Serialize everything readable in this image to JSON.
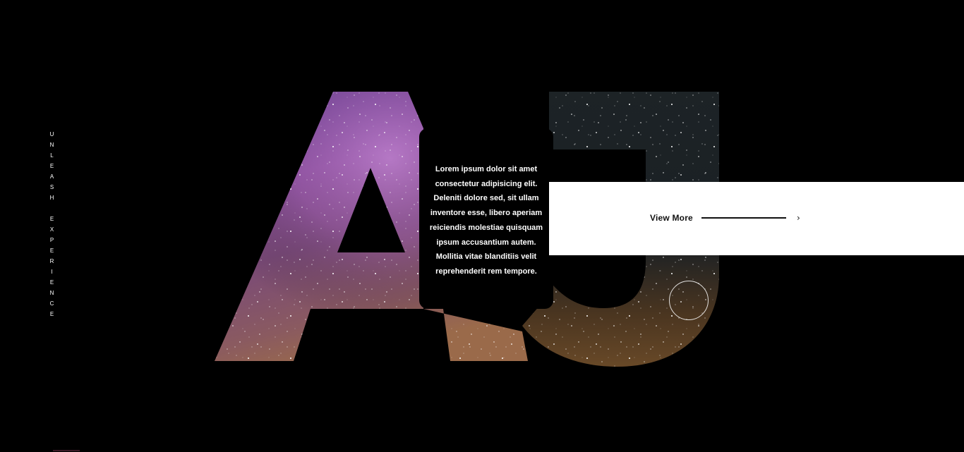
{
  "tagline": "UNLEASH EXPERIENCE",
  "hero": {
    "letters": "AJ"
  },
  "card": {
    "text": "Lorem ipsum dolor sit amet consectetur adipisicing elit. Deleniti dolore sed, sit ullam inventore esse, libero aperiam reiciendis molestiae quisquam ipsum accusantium autem. Mollitia vitae blanditiis velit reprehenderit rem tempore."
  },
  "cta": {
    "label": "View More",
    "arrow_icon": "chevron-right-icon"
  },
  "colors": {
    "background": "#000000",
    "band": "#ffffff",
    "text_light": "#ffffff",
    "text_dark": "#111111"
  }
}
